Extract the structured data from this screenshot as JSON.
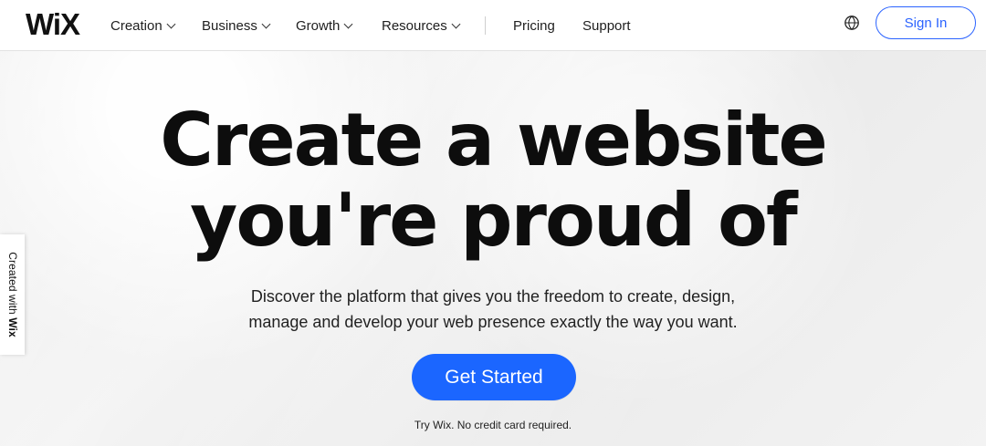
{
  "header": {
    "logo": "WiX",
    "nav": [
      {
        "label": "Creation"
      },
      {
        "label": "Business"
      },
      {
        "label": "Growth"
      },
      {
        "label": "Resources"
      },
      {
        "label": "Pricing"
      },
      {
        "label": "Support"
      }
    ],
    "language_icon": "globe-icon",
    "sign_in": "Sign In"
  },
  "hero": {
    "title_line_1": "Create a website",
    "title_line_2": "you're proud of",
    "subtitle_line_1": "Discover the platform that gives you the freedom to create, design,",
    "subtitle_line_2": "manage and develop your web presence exactly the way you want.",
    "cta": "Get Started",
    "note": "Try Wix. No credit card required."
  },
  "side_badge": {
    "prefix": "Created with ",
    "brand": "Wix"
  },
  "colors": {
    "accent": "#1B66FF",
    "text": "#0D0D0D"
  }
}
